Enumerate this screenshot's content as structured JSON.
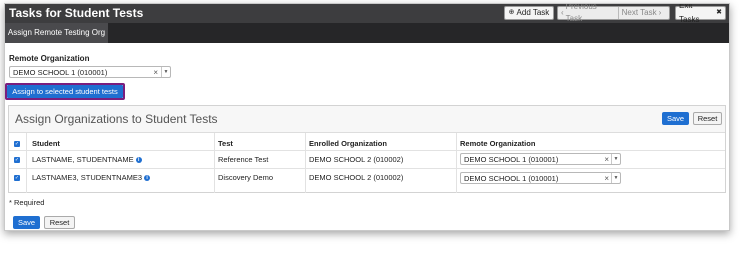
{
  "header": {
    "title": "Tasks for Student Tests",
    "add_task_label": "Add Task",
    "previous_task_label": "Previous Task",
    "next_task_label": "Next Task",
    "exit_tasks_label": "Exit Tasks"
  },
  "subnav": {
    "active_tab": "Assign Remote Testing Org"
  },
  "remote_org": {
    "label": "Remote Organization",
    "selected": "DEMO SCHOOL 1 (010001)",
    "assign_button": "Assign to selected student tests"
  },
  "panel": {
    "title": "Assign Organizations to Student Tests",
    "save_label": "Save",
    "reset_label": "Reset"
  },
  "table": {
    "columns": [
      "Student",
      "Test",
      "Enrolled Organization",
      "Remote Organization"
    ],
    "rows": [
      {
        "student": "LASTNAME, STUDENTNAME",
        "test": "Reference Test",
        "enrolled": "DEMO SCHOOL 2 (010002)",
        "remote": "DEMO SCHOOL 1 (010001)"
      },
      {
        "student": "LASTNAME3, STUDENTNAME3",
        "test": "Discovery Demo",
        "enrolled": "DEMO SCHOOL 2 (010002)",
        "remote": "DEMO SCHOOL 1 (010001)"
      }
    ]
  },
  "footer": {
    "required_note": "* Required",
    "save_label": "Save",
    "reset_label": "Reset"
  },
  "colors": {
    "primary": "#1f6fd1",
    "header_bg": "#3d3d3f",
    "highlight_outline": "#7a1e7e"
  }
}
